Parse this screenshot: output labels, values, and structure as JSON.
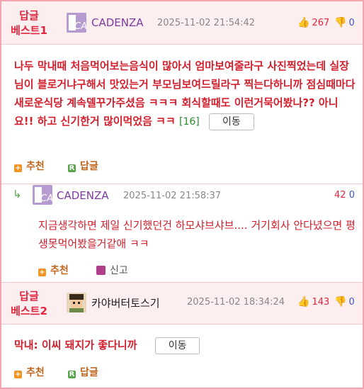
{
  "comments": [
    {
      "best_label_line1": "답글",
      "best_label_line2": "베스트1",
      "nickname": "CADENZA",
      "avatar_text": "CA",
      "date": "2025-11-02 21:54:42",
      "upvotes": "267",
      "downvotes": "0",
      "text": "나두 막내때 처음먹어보는음식이 많아서 엄마보여줄라구 사진찍었는데 실장님이 블로거냐구해서 맛있는거 부모님보여드릴라구 찍는다하니까 점심때마다 새로운식당 계속델꾸가주셨음 ㅋㅋㅋ 회식할때도 이런거묵어봤나?? 아니요!! 하고 신기한거 많이먹었음 ㅋㅋ",
      "reply_count": "[16]",
      "move_label": "이동",
      "recommend_label": "추천",
      "reply_label": "답글"
    },
    {
      "best_label_line1": "답글",
      "best_label_line2": "베스트2",
      "nickname": "카야버터토스기",
      "date": "2025-11-02 18:34:24",
      "upvotes": "143",
      "downvotes": "0",
      "text": "막내: 이씨 돼지가 좋다니까",
      "move_label": "이동",
      "recommend_label": "추천",
      "reply_label": "답글"
    }
  ],
  "reply": {
    "nickname": "CADENZA",
    "avatar_text": "CA",
    "date": "2025-11-02 21:58:37",
    "upvotes": "42",
    "text": "지금생각하면 제일 신기했던건 하모샤브샤브.... 거기회사 안다녔으면 평생못먹어봤을거같애 ㅋㅋ",
    "recommend_label": "추천",
    "report_label": "신고"
  },
  "colors": {
    "accent_red": "#e0273f",
    "header_bg": "#fdeef0",
    "border_pink": "#f2a5b0",
    "downvote_blue": "#3a56c9"
  },
  "icons": {
    "thumbs_up": "thumbs-up-icon",
    "thumbs_down": "thumbs-down-icon",
    "recommend": "plus-square-icon",
    "reply": "reply-r-icon",
    "report": "report-icon",
    "reply_arrow": "reply-arrow-icon"
  }
}
